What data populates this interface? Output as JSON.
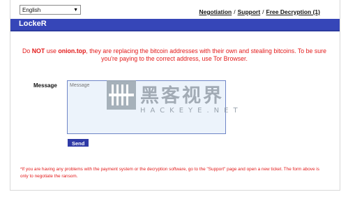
{
  "header": {
    "language_selected": "English",
    "app_title": "LockeR",
    "links": [
      "Negotiation",
      "Support",
      "Free Decryption (1)"
    ],
    "link_separator": "/"
  },
  "warning": {
    "part1": "Do ",
    "not": "NOT",
    "part2": " use ",
    "domain": "onion.top",
    "part3": ", they are replacing the bitcoin addresses with their own and stealing bitcoins. To be sure you're paying to the correct address, use Tor Browser."
  },
  "form": {
    "message_label": "Message",
    "message_placeholder": "Message",
    "message_value": "",
    "send_label": "Send"
  },
  "footnote": "*If you are having any problems with the payment system or the decryption software, go to the \"Support\" page and open a new ticket. The form above is only to negotiate the ransom.",
  "watermark": {
    "text": "黑客视界",
    "subtext": "HACKEYE.NET"
  },
  "colors": {
    "header_bar": "#3646b8",
    "warning_text": "#e31a1a",
    "send_button": "#2f3aa6",
    "textarea_bg": "#ecf3fb"
  }
}
